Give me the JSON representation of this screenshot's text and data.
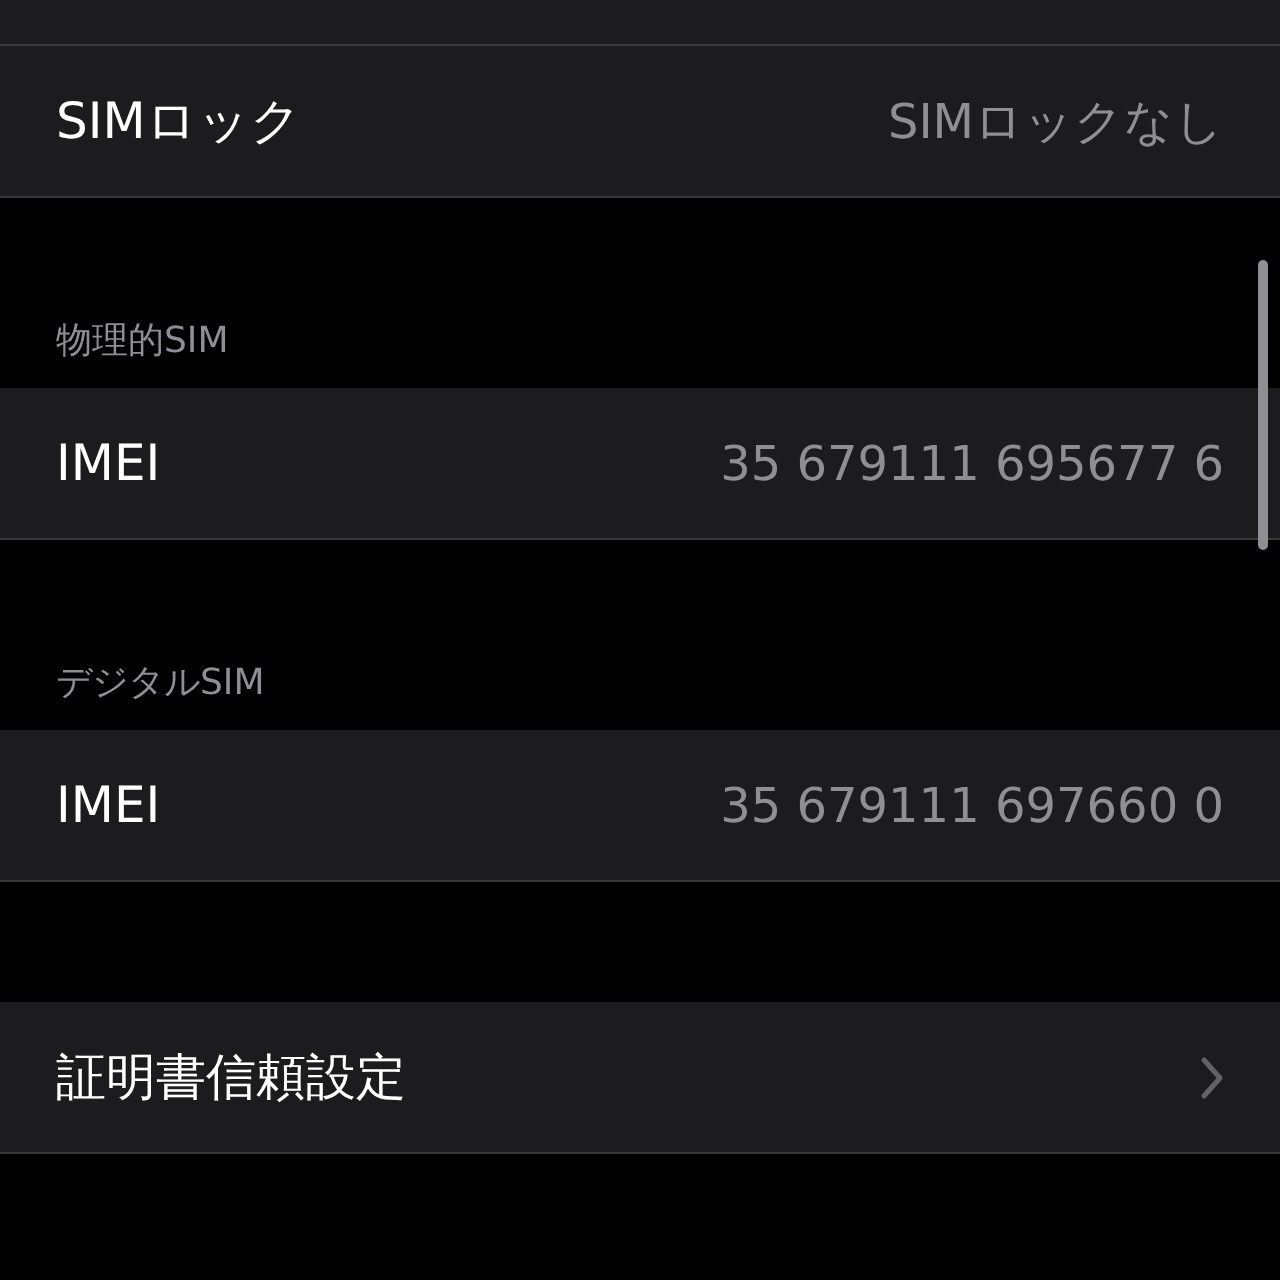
{
  "sections": [
    {
      "rows": [
        {
          "label": "SIMロック",
          "value": "SIMロックなし",
          "kind": "value"
        }
      ]
    },
    {
      "header": "物理的SIM",
      "rows": [
        {
          "label": "IMEI",
          "value": "35 679111 695677 6",
          "kind": "value"
        }
      ]
    },
    {
      "header": "デジタルSIM",
      "rows": [
        {
          "label": "IMEI",
          "value": "35 679111 697660 0",
          "kind": "value"
        }
      ]
    },
    {
      "rows": [
        {
          "label": "証明書信頼設定",
          "kind": "link"
        }
      ]
    }
  ]
}
